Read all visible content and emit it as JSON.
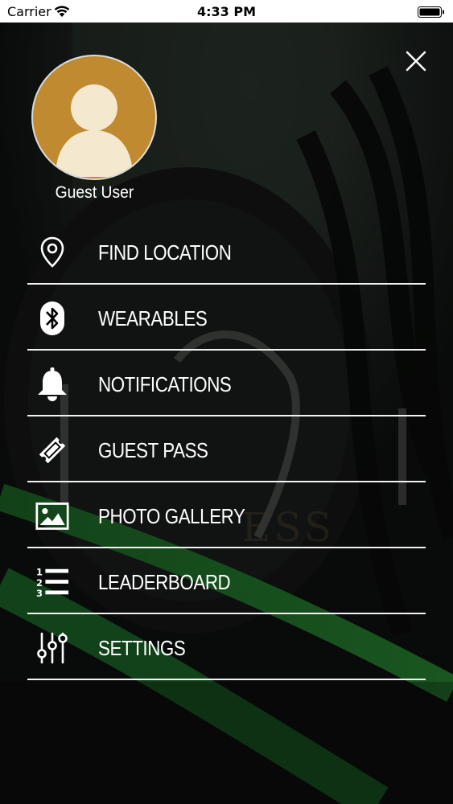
{
  "status_bar": {
    "carrier": "Carrier",
    "time": "4:33 PM",
    "wifi_icon": "wifi-icon",
    "battery_icon": "battery-icon"
  },
  "profile": {
    "name": "Guest User",
    "avatar_icon": "person-icon",
    "avatar_color": "#c08a31"
  },
  "close_icon": "close-icon",
  "menu": {
    "items": [
      {
        "label": "FIND LOCATION",
        "icon": "location-pin-icon"
      },
      {
        "label": "WEARABLES",
        "icon": "bluetooth-icon"
      },
      {
        "label": "NOTIFICATIONS",
        "icon": "bell-icon"
      },
      {
        "label": "GUEST PASS",
        "icon": "ticket-icon"
      },
      {
        "label": "PHOTO GALLERY",
        "icon": "image-icon"
      },
      {
        "label": "LEADERBOARD",
        "icon": "numbered-list-icon"
      },
      {
        "label": "SETTINGS",
        "icon": "sliders-icon"
      }
    ]
  },
  "colors": {
    "accent_green": "#39b54a",
    "divider": "#f2f2f2",
    "background": "#0b0d0c"
  }
}
